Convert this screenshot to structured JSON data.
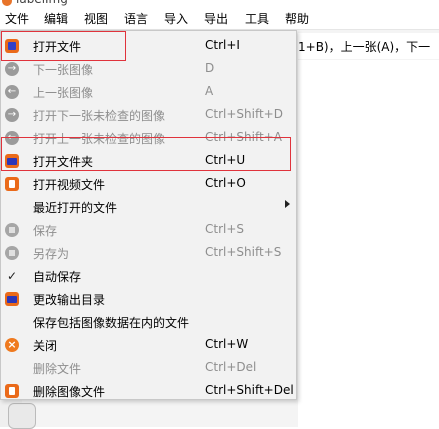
{
  "window": {
    "title": "labelImg"
  },
  "menubar": [
    "文件",
    "编辑",
    "视图",
    "语言",
    "导入",
    "导出",
    "工具",
    "帮助"
  ],
  "background": {
    "hint_text": "1+B)，上一张(A)，下一"
  },
  "file_menu": [
    {
      "label": "打开文件",
      "shortcut": "Ctrl+I",
      "icon": "open-file-icon",
      "enabled": true
    },
    {
      "label": "下一张图像",
      "shortcut": "D",
      "icon": "next-image-icon",
      "enabled": false
    },
    {
      "label": "上一张图像",
      "shortcut": "A",
      "icon": "prev-image-icon",
      "enabled": false
    },
    {
      "label": "打开下一张未检查的图像",
      "shortcut": "Ctrl+Shift+D",
      "icon": "next-unchecked-icon",
      "enabled": false
    },
    {
      "label": "打开上一张未检查的图像",
      "shortcut": "Ctrl+Shift+A",
      "icon": "prev-unchecked-icon",
      "enabled": false
    },
    {
      "label": "打开文件夹",
      "shortcut": "Ctrl+U",
      "icon": "open-folder-icon",
      "enabled": true
    },
    {
      "label": "打开视频文件",
      "shortcut": "Ctrl+O",
      "icon": "open-video-icon",
      "enabled": true
    },
    {
      "label": "最近打开的文件",
      "shortcut": "",
      "icon": "",
      "enabled": true,
      "submenu": true
    },
    {
      "label": "保存",
      "shortcut": "Ctrl+S",
      "icon": "save-icon",
      "enabled": false
    },
    {
      "label": "另存为",
      "shortcut": "Ctrl+Shift+S",
      "icon": "save-as-icon",
      "enabled": false
    },
    {
      "label": "自动保存",
      "shortcut": "",
      "icon": "check-icon",
      "enabled": true,
      "checked": true
    },
    {
      "label": "更改输出目录",
      "shortcut": "",
      "icon": "change-dir-icon",
      "enabled": true
    },
    {
      "label": "保存包括图像数据在内的文件",
      "shortcut": "",
      "icon": "",
      "enabled": true
    },
    {
      "label": "关闭",
      "shortcut": "Ctrl+W",
      "icon": "close-icon",
      "enabled": true
    },
    {
      "label": "删除文件",
      "shortcut": "Ctrl+Del",
      "icon": "",
      "enabled": false
    },
    {
      "label": "删除图像文件",
      "shortcut": "Ctrl+Shift+Del",
      "icon": "delete-image-icon",
      "enabled": true
    }
  ],
  "colors": {
    "highlight": "#e0333c",
    "accent": "#ea6a1a",
    "disabled_text": "#8e8e8e"
  }
}
